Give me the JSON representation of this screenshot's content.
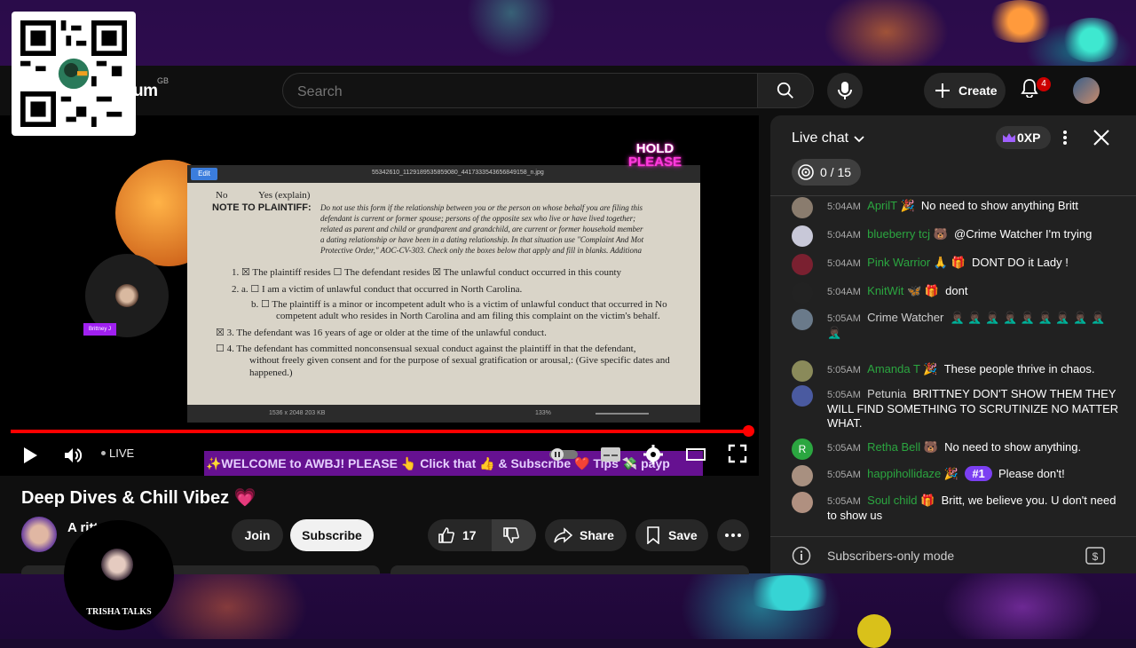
{
  "topbar": {
    "logo_partial": "um",
    "logo_region": "GB",
    "search_placeholder": "Search",
    "create_label": "Create",
    "notif_count": "4"
  },
  "video": {
    "hold_line1": "HOLD",
    "hold_line2": "PLEASE",
    "cam_tag": "Brittney J",
    "live_label": "LIVE",
    "welcome_text": "✨WELCOME to AWBJ! PLEASE 👆 Click that 👍 & Subscribe ❤️ Tips 💸 payp",
    "doc": {
      "toolbar_edit": "Edit",
      "file_name": "55342610_1129189535859080_4417333543656849158_n.jpg",
      "zoom": "133%",
      "no": "No",
      "yes": "Yes (explain)",
      "note_label": "NOTE TO PLAINTIFF:",
      "note_l1": "Do not use this form if the relationship between you or the person on whose behalf you are filing this",
      "note_l2": "defendant is current or former spouse; persons of the opposite sex who live or have lived together;",
      "note_l3": "related as parent and child or grandparent and grandchild, are current or former household member",
      "note_l4": "a dating relationship or have been in a dating relationship. In that situation use \"Complaint And Mot",
      "note_l5": "Protective Order,\" AOC-CV-303. Check only the boxes below that apply and fill in blanks. Additiona",
      "item1": "1.  ☒ The plaintiff resides     ☐ The defendant resides     ☒ The unlawful conduct occurred     in this county",
      "item2a": "2.  a.  ☐  I am a victim of unlawful conduct that occurred in North Carolina.",
      "item2b": "b.  ☐  The plaintiff is a minor or incompetent adult who is a victim of unlawful conduct that occurred in No",
      "item2b2": "competent adult who resides in North Carolina and am filing this complaint on the victim's behalf.",
      "item3": "☒  3.  The defendant was 16 years of age or older at the time of the unlawful conduct.",
      "item4": "☐  4.  The defendant has committed nonconsensual sexual conduct against the plaintiff in that the defendant,",
      "item4b": "without freely given consent and for the purpose of sexual gratification or arousal,: (Give specific dates and",
      "item4c": "happened.)",
      "bottom_info": "1536 x 2048   203 KB"
    }
  },
  "below": {
    "title": "Deep Dives & Chill Vibez 💗",
    "channel_name": "A                rittney J",
    "join_label": "Join",
    "subscribe_label": "Subscribe",
    "like_count": "17",
    "share_label": "Share",
    "save_label": "Save"
  },
  "overlay": {
    "trisha_label": "TRISHA TALKS"
  },
  "chat": {
    "title": "Live chat",
    "xp": "0XP",
    "goal": "0 / 15",
    "footer": "Subscribers-only mode",
    "messages": [
      {
        "time": "5:04AM",
        "name": "AprilT 🎉",
        "text": "No need to show anything Britt",
        "name_color": "#2ba640",
        "avatar": "#8a7c6e"
      },
      {
        "time": "5:04AM",
        "name": "blueberry tcj 🐻",
        "text": "@Crime Watcher I'm trying",
        "name_color": "#2ba640",
        "avatar": "#c8c8d8"
      },
      {
        "time": "5:04AM",
        "name": "Pink Warrior 🙏 🎁",
        "text": "DONT DO it Lady !",
        "name_color": "#2ba640",
        "avatar": "#7a2030"
      },
      {
        "time": "5:04AM",
        "name": "KnitWit 🦋 🎁",
        "text": "dont",
        "name_color": "#2ba640",
        "avatar": "#222"
      },
      {
        "time": "5:05AM",
        "name": "Crime Watcher",
        "text": "🤦🏿‍♂️ 🤦🏿‍♂️ 🤦🏿‍♂️ 🤦🏿‍♂️ 🤦🏿‍♂️ 🤦🏿‍♂️ 🤦🏿‍♂️ 🤦🏿‍♂️ 🤦🏿‍♂️ 🤦🏿‍♂️",
        "name_color": "#cfcfcf",
        "avatar": "#6a7a8a"
      },
      {
        "time": "5:05AM",
        "name": "Amanda T 🎉",
        "text": "These people thrive in chaos.",
        "name_color": "#2ba640",
        "avatar": "#8a8a5a"
      },
      {
        "time": "5:05AM",
        "name": "Petunia",
        "text": "BRITTNEY DON'T SHOW THEM THEY WILL FIND SOMETHING TO SCRUTINIZE NO MATTER WHAT.",
        "name_color": "#cfcfcf",
        "avatar": "#4a5aa0"
      },
      {
        "time": "5:05AM",
        "name": "Retha Bell 🐻",
        "text": "No need to show anything.",
        "name_color": "#2ba640",
        "avatar": "#2ba640",
        "initial": "R"
      },
      {
        "time": "5:05AM",
        "name": "happihollidaze 🎉",
        "text": "Please don't!",
        "badge": "#1",
        "name_color": "#2ba640",
        "avatar": "#a89080"
      },
      {
        "time": "5:05AM",
        "name": "Soul child 🎁",
        "text": "Britt, we believe you. U don't need to show us",
        "name_color": "#2ba640",
        "avatar": "#b09080"
      }
    ]
  },
  "colors": {
    "accent_red": "#ff0000",
    "chat_green": "#2ba640",
    "bg": "#0f0f0f"
  }
}
